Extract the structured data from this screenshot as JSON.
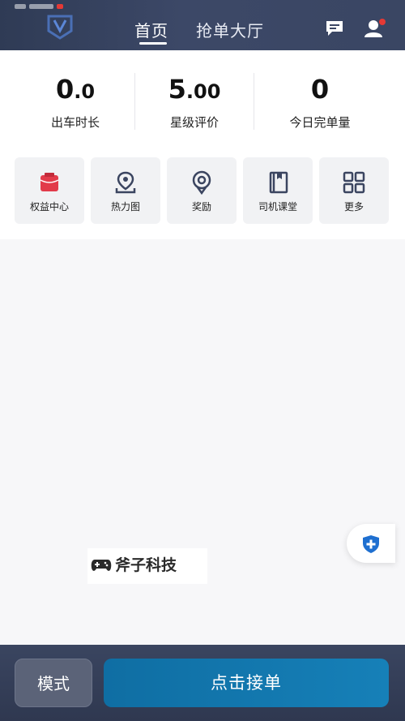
{
  "header": {
    "tabs": [
      {
        "label": "首页",
        "active": true
      },
      {
        "label": "抢单大厅",
        "active": false
      }
    ],
    "logo_icon": "app-logo-icon",
    "message_icon": "message-icon",
    "profile_icon": "user-profile-icon",
    "profile_badge_color": "#e53935"
  },
  "stats": [
    {
      "value_main": "0",
      "value_small": ".0",
      "label": "出车时长"
    },
    {
      "value_main": "5",
      "value_small": ".00",
      "label": "星级评价"
    },
    {
      "value_main": "0",
      "value_small": "",
      "label": "今日完单量"
    }
  ],
  "quick_menu": [
    {
      "label": "权益中心",
      "icon": "benefits-center-icon",
      "color": "#e23b4a"
    },
    {
      "label": "热力图",
      "icon": "heatmap-location-icon",
      "color": "#3b4560"
    },
    {
      "label": "奖励",
      "icon": "reward-badge-icon",
      "color": "#3b4560"
    },
    {
      "label": "司机课堂",
      "icon": "driver-classroom-book-icon",
      "color": "#3b4560"
    },
    {
      "label": "更多",
      "icon": "more-grid-icon",
      "color": "#3b4560"
    }
  ],
  "watermark": {
    "text": "斧子科技",
    "icon": "gamepad-icon"
  },
  "floating_button": {
    "icon": "safety-shield-icon",
    "color": "#1e6fd0"
  },
  "bottom_bar": {
    "mode_label": "模式",
    "accept_label": "点击接单"
  }
}
